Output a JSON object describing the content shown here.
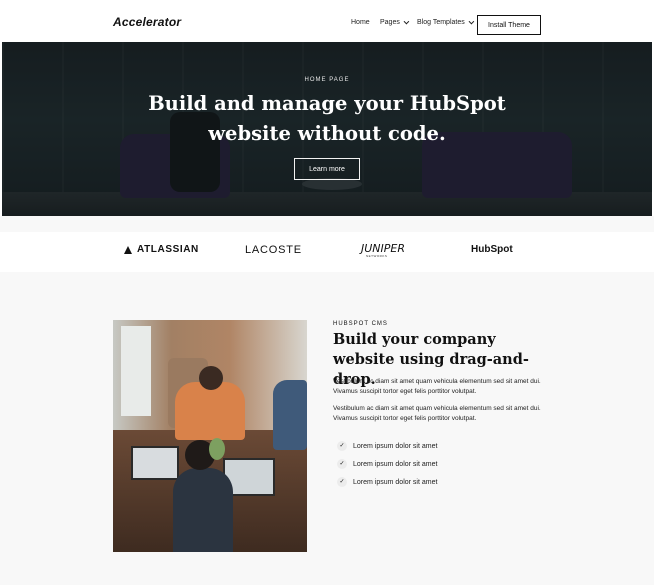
{
  "header": {
    "logo": "Accelerator",
    "nav": [
      {
        "label": "Home",
        "has_dropdown": false
      },
      {
        "label": "Pages",
        "has_dropdown": true
      },
      {
        "label": "Blog Templates",
        "has_dropdown": true
      }
    ],
    "cta_label": "Install Theme"
  },
  "hero": {
    "eyebrow": "HOME PAGE",
    "title_line1": "Build and manage your HubSpot",
    "title_line2": "website without code.",
    "button_label": "Learn more"
  },
  "logos": {
    "atlassian": "ATLASSIAN",
    "lacoste": "LACOSTE",
    "juniper": "JUNIPER",
    "juniper_sub": "NETWORKS",
    "hubspot": "HubSpot"
  },
  "feature": {
    "eyebrow": "HUBSPOT CMS",
    "title": "Build your company website using drag-and-drop.",
    "paragraphs": [
      "Vestibulum ac diam sit amet quam vehicula elementum sed sit amet dui. Vivamus suscipit tortor eget felis porttitor volutpat.",
      "Vestibulum ac diam sit amet quam vehicula elementum sed sit amet dui. Vivamus suscipit tortor eget felis porttitor volutpat."
    ],
    "checklist": [
      "Lorem ipsum dolor sit amet",
      "Lorem ipsum dolor sit amet",
      "Lorem ipsum dolor sit amet"
    ]
  },
  "icons": {
    "chevron": "chevron-down-icon",
    "check": "check-icon"
  },
  "colors": {
    "text": "#111111",
    "hero_overlay": "#1d2528",
    "section_bg": "#f8f8f8"
  }
}
